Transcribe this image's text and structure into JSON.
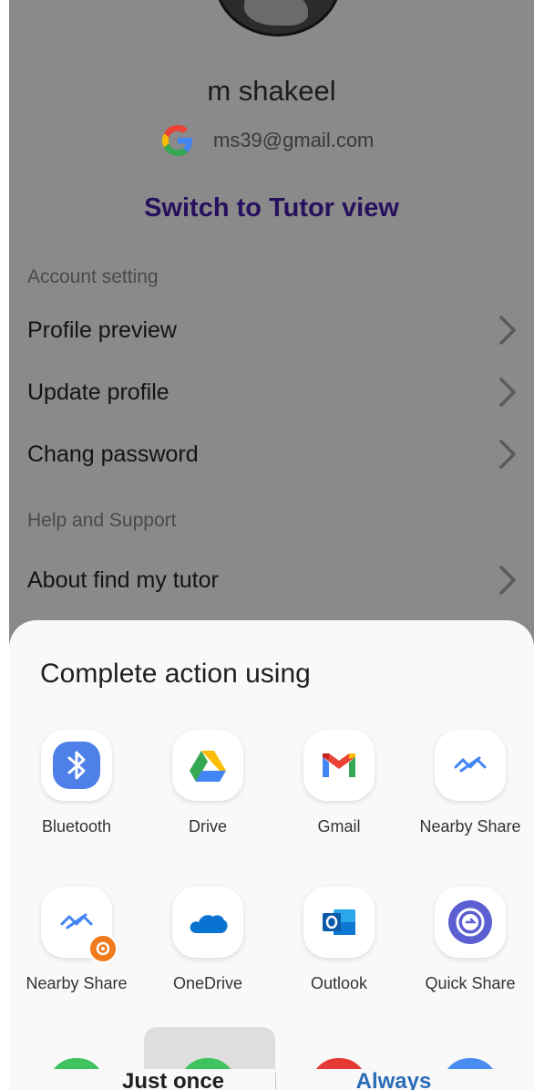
{
  "profile": {
    "name": "m shakeel",
    "email": "ms39@gmail.com",
    "switch_label": "Switch to Tutor view",
    "account_section": "Account setting",
    "help_section": "Help and Support",
    "menu": [
      {
        "label": "Profile preview"
      },
      {
        "label": "Update profile"
      },
      {
        "label": "Chang password"
      },
      {
        "label": "About find my tutor"
      }
    ]
  },
  "sheet": {
    "title": "Complete action using",
    "apps": [
      {
        "label": "Bluetooth",
        "icon": "bluetooth-icon"
      },
      {
        "label": "Drive",
        "icon": "google-drive-icon"
      },
      {
        "label": "Gmail",
        "icon": "gmail-icon"
      },
      {
        "label": "Nearby Share",
        "icon": "nearby-share-icon"
      },
      {
        "label": "Nearby Share",
        "icon": "nearby-share-icon"
      },
      {
        "label": "OneDrive",
        "icon": "onedrive-icon"
      },
      {
        "label": "Outlook",
        "icon": "outlook-icon"
      },
      {
        "label": "Quick Share",
        "icon": "quick-share-icon"
      }
    ],
    "buttons": {
      "once": "Just once",
      "always": "Always"
    }
  },
  "colors": {
    "scrim": "#8a8a8a",
    "switch_link": "#27105e",
    "always_button": "#2b6cb8",
    "bluetooth": "#4f7fe8",
    "quick_share": "#5b5fd1"
  }
}
